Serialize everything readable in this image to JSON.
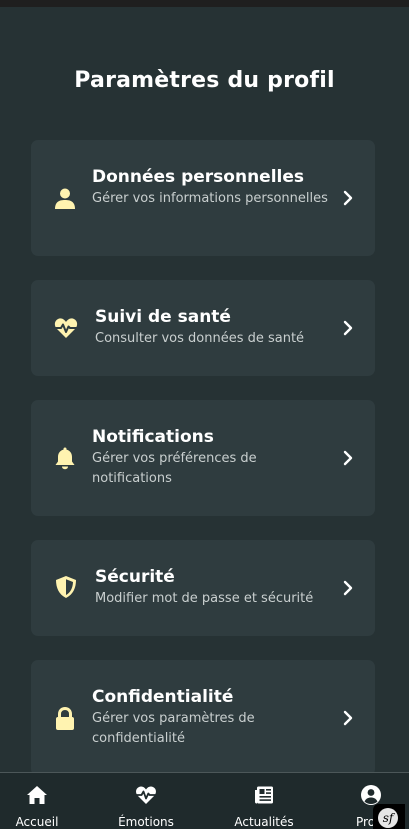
{
  "page": {
    "title": "Paramètres du profil"
  },
  "colors": {
    "background": "#263234",
    "card": "#2f3c3f",
    "icon_accent": "#fff3b0",
    "nav_background": "#1f2a2c"
  },
  "cards": [
    {
      "icon": "user-icon",
      "title": "Données personnelles",
      "desc": "Gérer vos informations personnelles"
    },
    {
      "icon": "heartbeat-icon",
      "title": "Suivi de santé",
      "desc": "Consulter vos données de santé"
    },
    {
      "icon": "bell-icon",
      "title": "Notifications",
      "desc": "Gérer vos préférences de notifications"
    },
    {
      "icon": "shield-icon",
      "title": "Sécurité",
      "desc": "Modifier mot de passe et sécurité"
    },
    {
      "icon": "lock-icon",
      "title": "Confidentialité",
      "desc": "Gérer vos paramètres de confidentialité"
    }
  ],
  "nav": {
    "items": [
      {
        "icon": "home-icon",
        "label": "Accueil"
      },
      {
        "icon": "heartbeat-icon",
        "label": "Émotions"
      },
      {
        "icon": "newspaper-icon",
        "label": "Actualités"
      },
      {
        "icon": "user-circle-icon",
        "label": "Profil"
      }
    ]
  },
  "debug_badge": {
    "label": "sf"
  }
}
